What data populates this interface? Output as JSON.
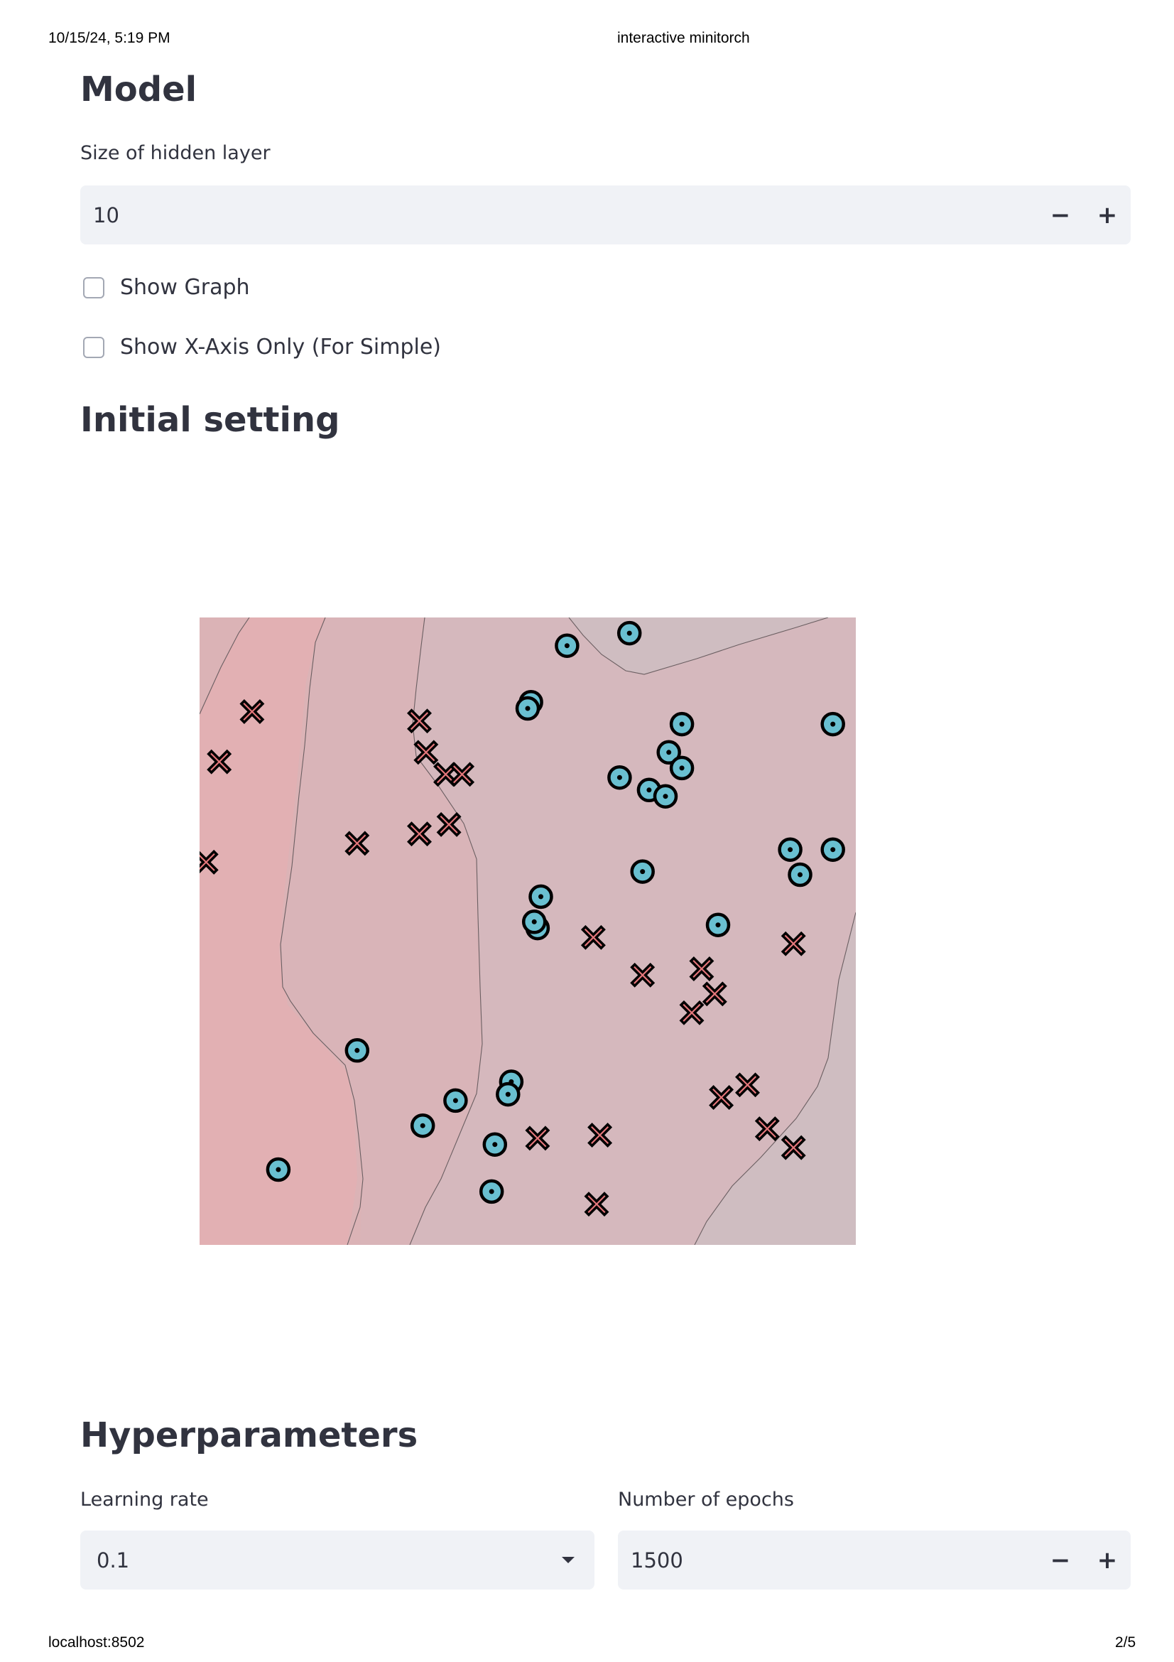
{
  "print": {
    "datetime": "10/15/24, 5:19 PM",
    "title": "interactive minitorch",
    "url": "localhost:8502",
    "page": "2/5"
  },
  "model": {
    "heading": "Model",
    "hidden_label": "Size of hidden layer",
    "hidden_value": "10",
    "minus": "−",
    "plus": "+",
    "show_graph": "Show Graph",
    "show_x_axis": "Show X-Axis Only (For Simple)"
  },
  "initial": {
    "heading": "Initial setting"
  },
  "hyper": {
    "heading": "Hyperparameters",
    "lr_label": "Learning rate",
    "lr_value": "0.1",
    "epochs_label": "Number of epochs",
    "epochs_value": "1500"
  },
  "colors": {
    "class0": "#e5777b",
    "class1": "#69bfd0"
  },
  "chart_data": {
    "type": "scatter",
    "title": "",
    "xlim": [
      0,
      1
    ],
    "ylim": [
      0,
      1
    ],
    "series": [
      {
        "marker": "x",
        "color": "#e5777b",
        "points": [
          [
            0.08,
            0.85
          ],
          [
            0.03,
            0.77
          ],
          [
            0.01,
            0.61
          ],
          [
            0.24,
            0.64
          ],
          [
            0.335,
            0.835
          ],
          [
            0.345,
            0.785
          ],
          [
            0.375,
            0.75
          ],
          [
            0.4,
            0.75
          ],
          [
            0.335,
            0.655
          ],
          [
            0.38,
            0.67
          ],
          [
            0.6,
            0.49
          ],
          [
            0.675,
            0.43
          ],
          [
            0.765,
            0.44
          ],
          [
            0.785,
            0.4
          ],
          [
            0.75,
            0.37
          ],
          [
            0.905,
            0.48
          ],
          [
            0.835,
            0.255
          ],
          [
            0.795,
            0.235
          ],
          [
            0.865,
            0.185
          ],
          [
            0.905,
            0.155
          ],
          [
            0.515,
            0.17
          ],
          [
            0.61,
            0.175
          ],
          [
            0.605,
            0.065
          ]
        ]
      },
      {
        "marker": "o",
        "color": "#69bfd0",
        "points": [
          [
            0.56,
            0.955
          ],
          [
            0.655,
            0.975
          ],
          [
            0.505,
            0.865
          ],
          [
            0.5,
            0.855
          ],
          [
            0.735,
            0.83
          ],
          [
            0.965,
            0.83
          ],
          [
            0.715,
            0.785
          ],
          [
            0.735,
            0.76
          ],
          [
            0.64,
            0.745
          ],
          [
            0.685,
            0.725
          ],
          [
            0.71,
            0.715
          ],
          [
            0.9,
            0.63
          ],
          [
            0.965,
            0.63
          ],
          [
            0.915,
            0.59
          ],
          [
            0.675,
            0.595
          ],
          [
            0.52,
            0.555
          ],
          [
            0.515,
            0.505
          ],
          [
            0.51,
            0.515
          ],
          [
            0.79,
            0.51
          ],
          [
            0.24,
            0.31
          ],
          [
            0.475,
            0.26
          ],
          [
            0.47,
            0.24
          ],
          [
            0.39,
            0.23
          ],
          [
            0.34,
            0.19
          ],
          [
            0.45,
            0.16
          ],
          [
            0.12,
            0.12
          ],
          [
            0.445,
            0.085
          ]
        ]
      }
    ]
  }
}
